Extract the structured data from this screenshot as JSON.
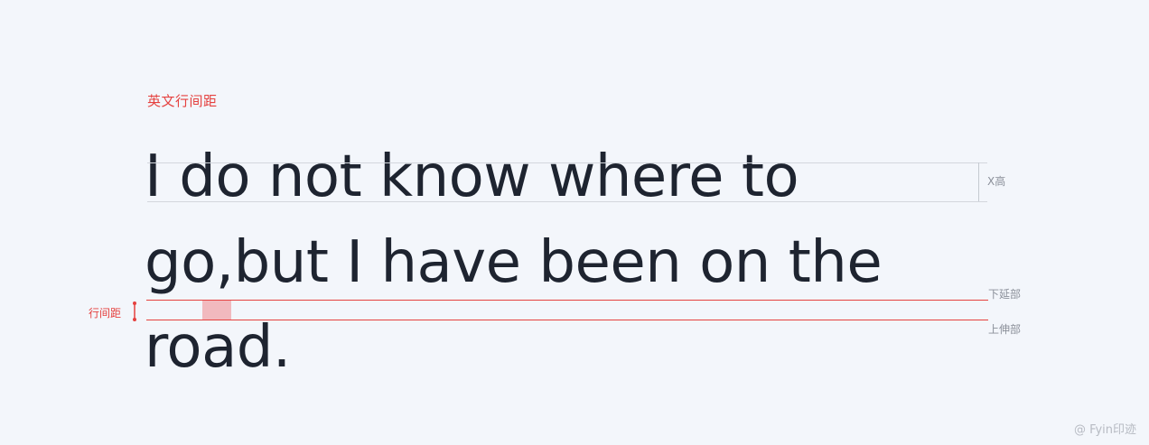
{
  "section_title": "英文行间距",
  "sample_text": {
    "lines": [
      "I do not know where to",
      "go,but I have been on the",
      "road."
    ]
  },
  "annotations": {
    "x_height": "X高",
    "descender": "下延部",
    "ascender": "上伸部",
    "leading": "行间距"
  },
  "watermark": "@ Fyin印迹",
  "colors": {
    "accent": "#e5413f",
    "text": "#1e2430",
    "guide": "#d3d7dd",
    "background": "#f3f6fb",
    "highlight": "#f06e73"
  }
}
